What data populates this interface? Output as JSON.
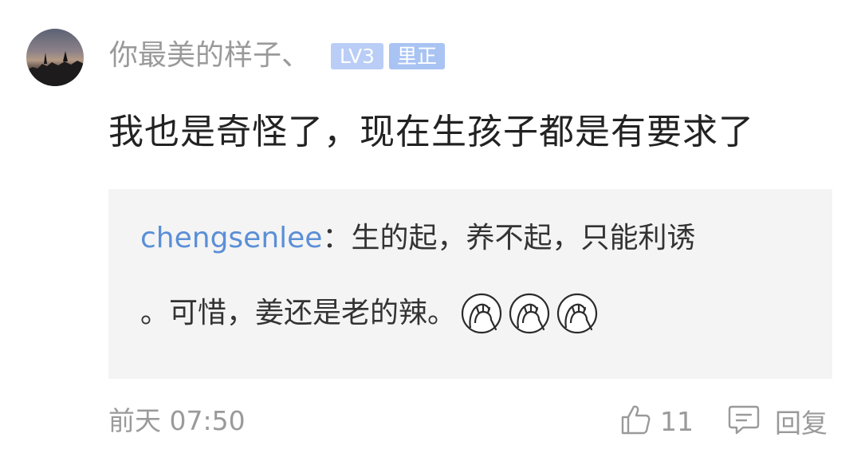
{
  "comment": {
    "username": "你最美的样子、",
    "level_badge": "LV3",
    "name_badge": "里正",
    "text": "我也是奇怪了，现在生孩子都是有要求了",
    "quote": {
      "author": "chengsenlee",
      "separator": "：",
      "line1_text": "生的起，养不起，只能利诱",
      "line2_text": "。可惜，姜还是老的辣。",
      "emojis": [
        "facepalm-emoji",
        "facepalm-emoji",
        "facepalm-emoji"
      ]
    },
    "time": "前天 07:50",
    "like_count": "11",
    "reply_label": "回复"
  },
  "colors": {
    "username": "#9a9a9a",
    "badge_level_bg": "#b9cdf6",
    "badge_name_bg": "#a9c3f3",
    "author_link": "#5b8fd6",
    "quote_bg": "#f4f4f5",
    "meta_text": "#9a9a9a"
  },
  "icons": {
    "like": "thumbs-up-icon",
    "reply": "comment-bubble-icon"
  }
}
